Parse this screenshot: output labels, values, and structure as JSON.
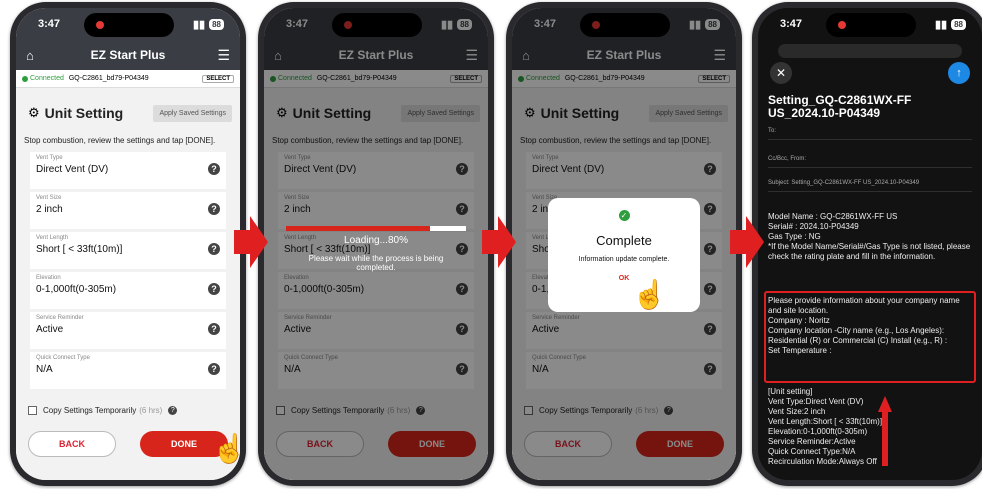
{
  "status": {
    "time": "3:47",
    "battery": "88"
  },
  "app": {
    "title": "EZ Start Plus",
    "connected": "Connected",
    "device": "GQ-C2861_bd79-P04349",
    "select": "SELECT"
  },
  "unit": {
    "title": "Unit Setting",
    "apply": "Apply Saved Settings",
    "instruction": "Stop combustion, review the settings and tap [DONE].",
    "fields": [
      {
        "label": "Vent Type",
        "value": "Direct Vent (DV)"
      },
      {
        "label": "Vent Size",
        "value": "2 inch"
      },
      {
        "label": "Vent Length",
        "value": "Short [ < 33ft(10m)]"
      },
      {
        "label": "Elevation",
        "value": "0-1,000ft(0-305m)"
      },
      {
        "label": "Service Reminder",
        "value": "Active"
      },
      {
        "label": "Quick Connect Type",
        "value": "N/A"
      }
    ],
    "copy_label": "Copy Settings Temporarily",
    "copy_hours": "(6 hrs)",
    "back": "BACK",
    "done": "DONE"
  },
  "loading": {
    "text": "Loading...80%",
    "progress": 0.8,
    "sub": "Please wait while the process is being completed."
  },
  "complete": {
    "title": "Complete",
    "message": "Information update complete.",
    "ok": "OK"
  },
  "email": {
    "subject": "Setting_GQ-C2861WX-FF US_2024.10-P04349",
    "to": "To:",
    "cc": "Cc/Bcc, From:",
    "subject_row": "Subject: Setting_GQ-C2861WX-FF US_2024.10-P04349",
    "lines1": [
      "Model Name : GQ-C2861WX-FF US",
      "Serial# : 2024.10-P04349",
      "Gas Type : NG",
      "*If the Model Name/Serial#/Gas Type is not listed, please check the rating plate and fill in the information."
    ],
    "lines2": [
      "Please provide information about your company name and site location.",
      "Company : Noritz",
      "Company location -City name (e.g., Los Angeles):",
      "Residential (R) or Commercial (C) Install (e.g., R) :",
      "Set Temperature :"
    ],
    "lines3": [
      "[Unit setting]",
      "Vent Type:Direct Vent (DV)",
      "Vent Size:2 inch",
      "Vent Length:Short [ < 33ft(10m)]",
      "Elevation:0-1,000ft(0-305m)",
      "Service Reminder:Active",
      "Quick Connect Type:N/A",
      "Recirculation Mode:Always Off"
    ]
  },
  "icons": [
    "home-icon",
    "menu-icon",
    "gear-icon",
    "help-icon",
    "checkmark-icon",
    "close-icon",
    "send-arrow-icon",
    "hand-pointer-icon",
    "red-arrow-icon"
  ]
}
